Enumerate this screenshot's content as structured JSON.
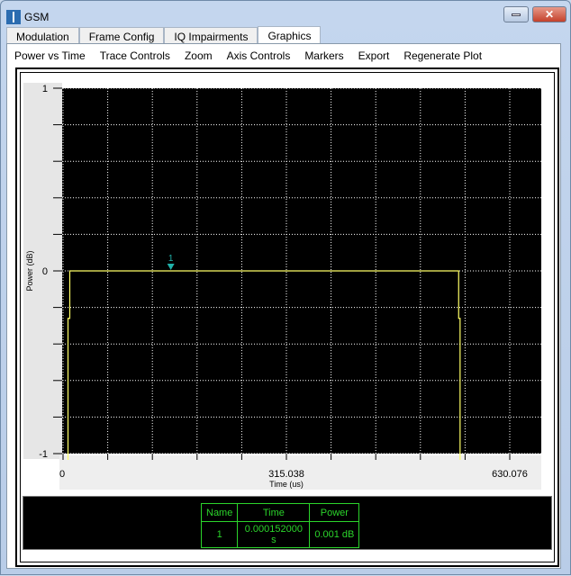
{
  "window": {
    "title": "GSM",
    "icon": "app-signal-icon",
    "minimize_icon": "minimize-icon",
    "close_icon": "close-icon"
  },
  "tabs": [
    {
      "label": "Modulation"
    },
    {
      "label": "Frame Config"
    },
    {
      "label": "IQ Impairments"
    },
    {
      "label": "Graphics",
      "active": true
    }
  ],
  "menu": [
    "Power vs Time",
    "Trace Controls",
    "Zoom",
    "Axis Controls",
    "Markers",
    "Export",
    "Regenerate Plot"
  ],
  "colors": {
    "plot_bg": "#000000",
    "trace": "#ffff66",
    "grid": "#ffffff",
    "marker": "#20b2aa",
    "table": "#2bd42b"
  },
  "chart_data": {
    "type": "line",
    "xlabel": "Time (us)",
    "ylabel": "Power (dB)",
    "xlim": [
      0,
      630.076
    ],
    "ylim": [
      -1,
      1
    ],
    "xtick_labels": [
      "0",
      "315.038",
      "630.076"
    ],
    "ytick_labels": [
      "1",
      "0",
      "-1"
    ],
    "grid": true,
    "series": [
      {
        "x": [
          7,
          7,
          9.5,
          9.5,
          558,
          558,
          560,
          560
        ],
        "y": [
          -2,
          -0.26,
          -0.26,
          0,
          0,
          -0.26,
          -0.26,
          -2
        ]
      }
    ],
    "markers": [
      {
        "label": "1",
        "x": 152,
        "y": 0
      }
    ]
  },
  "marker_table": {
    "headers": [
      "Name",
      "Time",
      "Power"
    ],
    "rows": [
      [
        "1",
        "0.000152000 s",
        "0.001 dB"
      ]
    ]
  }
}
